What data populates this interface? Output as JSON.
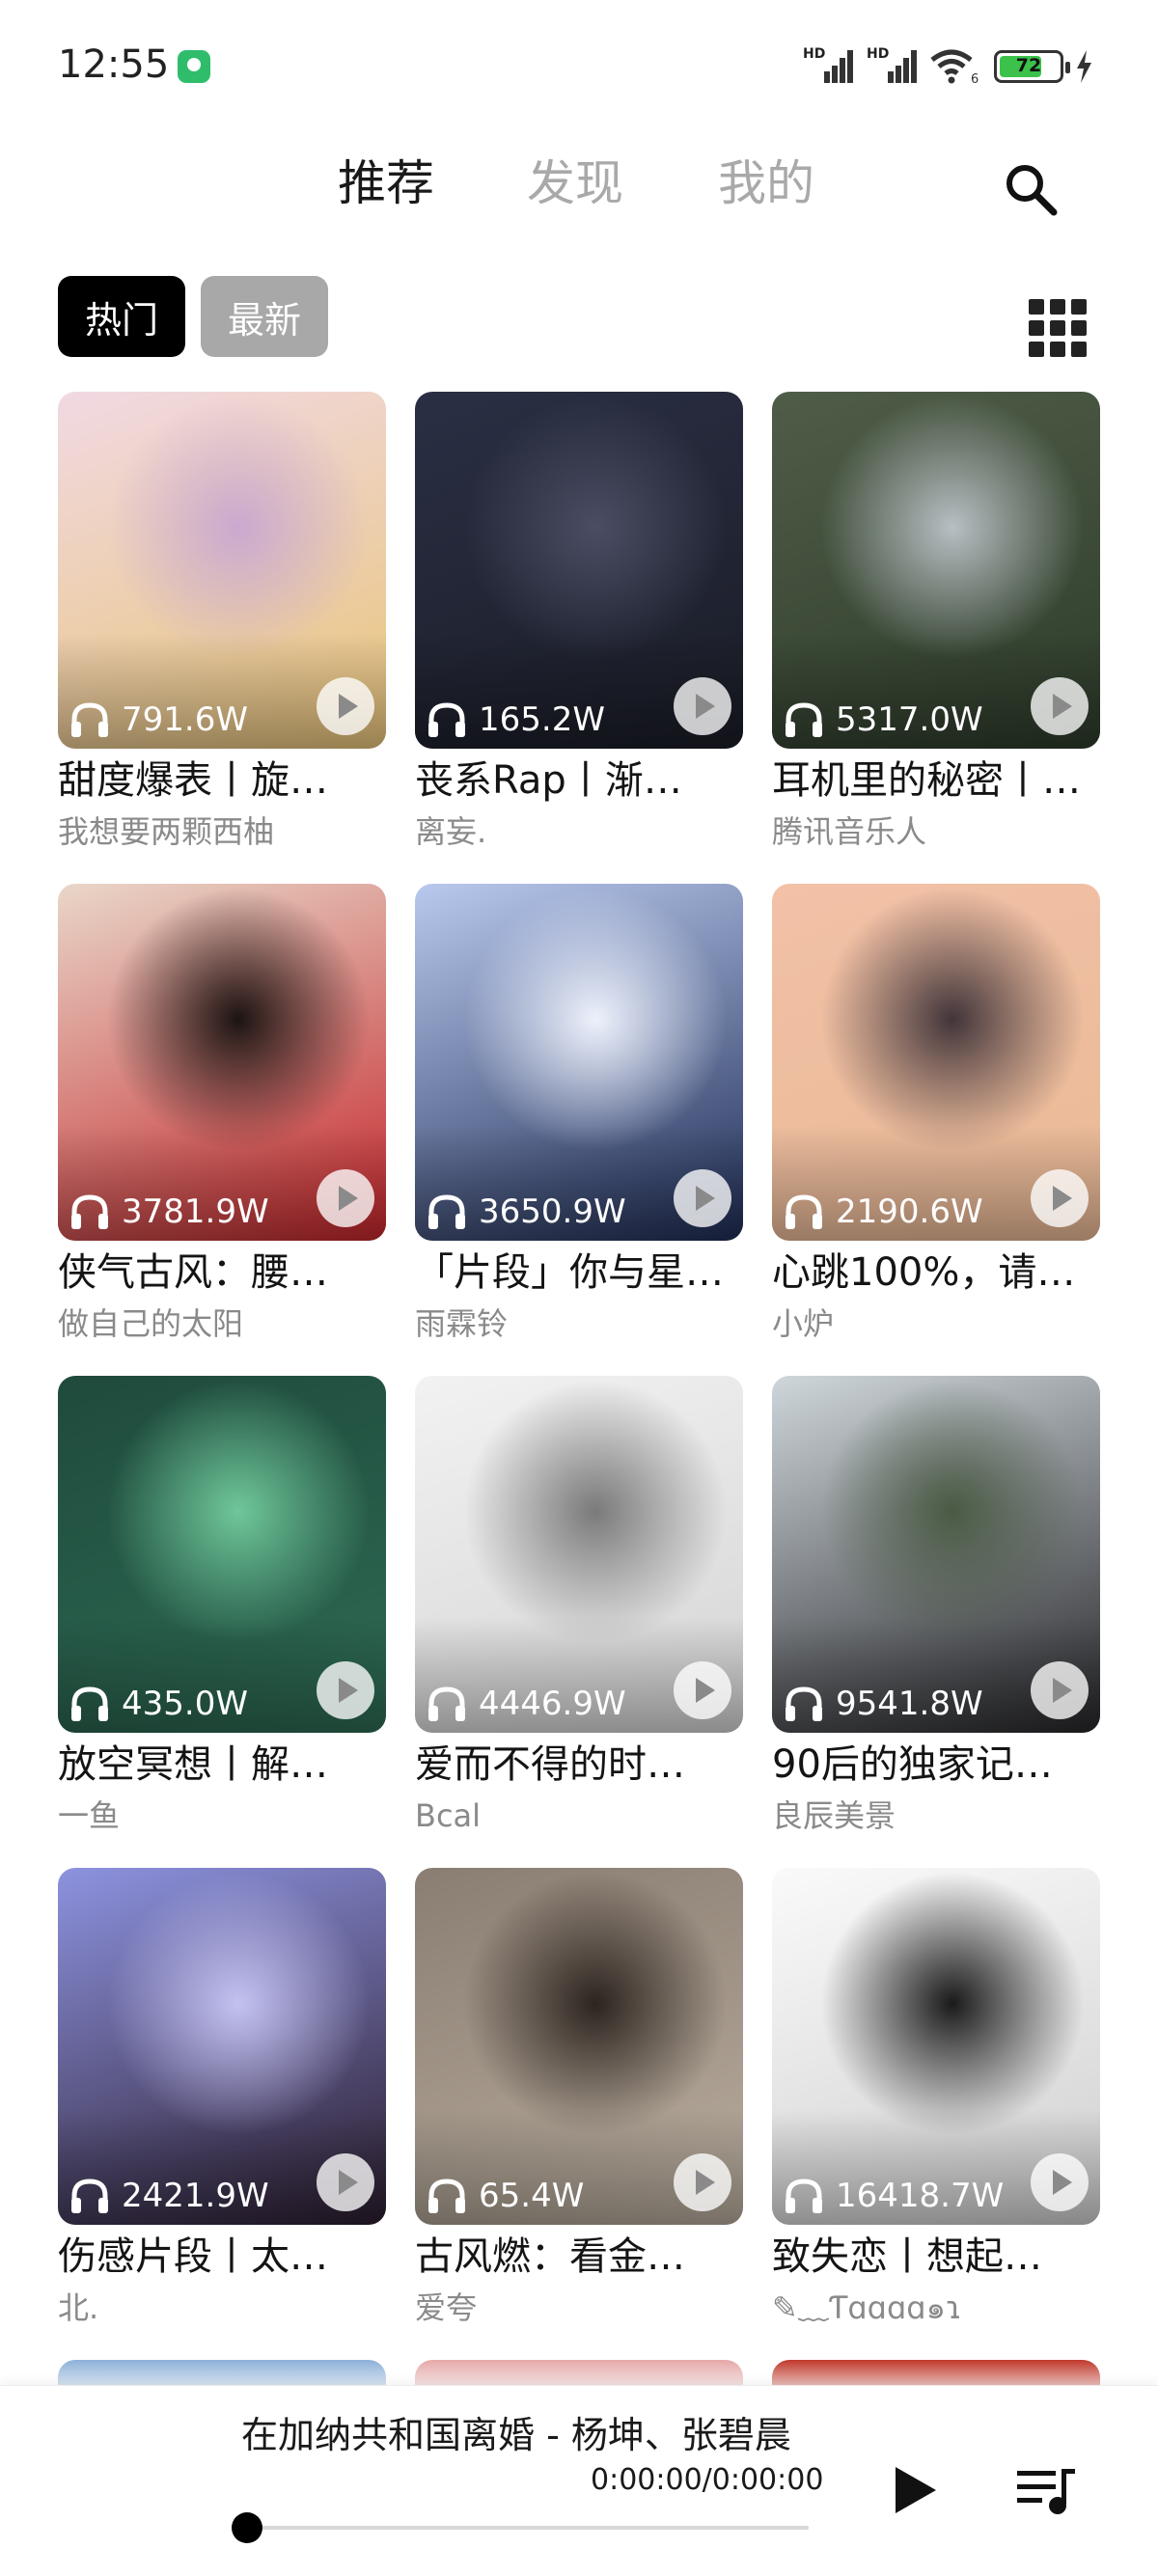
{
  "status_bar": {
    "time": "12:55",
    "signal1_label": "HD",
    "signal2_label": "HD",
    "wifi_label": "6",
    "battery_level": "72",
    "battery_fraction": 0.72,
    "charging": true
  },
  "top_tabs": [
    {
      "label": "推荐",
      "active": true
    },
    {
      "label": "发现",
      "active": false
    },
    {
      "label": "我的",
      "active": false
    }
  ],
  "filters": {
    "hot": "热门",
    "new": "最新"
  },
  "playlists": [
    {
      "plays": "791.6W",
      "title": "甜度爆表丨旋…",
      "author": "我想要两颗西柚",
      "colors": [
        "#f1d9e3",
        "#c9a9cf",
        "#e9c57a"
      ]
    },
    {
      "plays": "165.2W",
      "title": "丧系Rap丨渐…",
      "author": "离妄.",
      "colors": [
        "#2a2f44",
        "#4b4e63",
        "#1a1c26"
      ]
    },
    {
      "plays": "5317.0W",
      "title": "耳机里的秘密丨…",
      "author": "腾讯音乐人",
      "colors": [
        "#4f5d48",
        "#b7bfc3",
        "#2d3b2a"
      ]
    },
    {
      "plays": "3781.9W",
      "title": "侠气古风：腰…",
      "author": "做自己的太阳",
      "colors": [
        "#e9d7c9",
        "#1c1412",
        "#c4262b"
      ]
    },
    {
      "plays": "3650.9W",
      "title": "「片段」你与星…",
      "author": "雨霖铃",
      "colors": [
        "#b9c9ee",
        "#edf1fb",
        "#1f2d55"
      ]
    },
    {
      "plays": "2190.6W",
      "title": "心跳100%，请…",
      "author": "小炉",
      "colors": [
        "#f2c1a7",
        "#42353a",
        "#e9b995"
      ]
    },
    {
      "plays": "435.0W",
      "title": "放空冥想丨解…",
      "author": "一鱼",
      "colors": [
        "#1f4a3c",
        "#6fc79a",
        "#2e6b54"
      ]
    },
    {
      "plays": "4446.9W",
      "title": "爱而不得的时…",
      "author": "Bcal",
      "colors": [
        "#f2f2f2",
        "#7a7a7a",
        "#d4d4d4"
      ]
    },
    {
      "plays": "9541.8W",
      "title": "90后的独家记…",
      "author": "良辰美景",
      "colors": [
        "#cfd7dc",
        "#4a5a44",
        "#262629"
      ]
    },
    {
      "plays": "2421.9W",
      "title": "伤感片段丨太…",
      "author": "北.",
      "colors": [
        "#8d93e0",
        "#c4c2f0",
        "#2b1d2d"
      ]
    },
    {
      "plays": "65.4W",
      "title": "古风燃：看金…",
      "author": "爱夸",
      "colors": [
        "#8a7d72",
        "#2c241f",
        "#b9ad9e"
      ]
    },
    {
      "plays": "16418.7W",
      "title": "致失恋丨想起…",
      "author": "✎﹏Ƭɑɑɑɑ๑ɿ",
      "colors": [
        "#fafafa",
        "#1a1a1a",
        "#cfcfcf"
      ]
    }
  ],
  "peek_colors": [
    "#8db0d8",
    "#e5a9a9",
    "#c0392b"
  ],
  "player": {
    "now_playing": "在加纳共和国离婚 - 杨坤、张碧晨",
    "time": "0:00:00/0:00:00",
    "progress": 0
  }
}
